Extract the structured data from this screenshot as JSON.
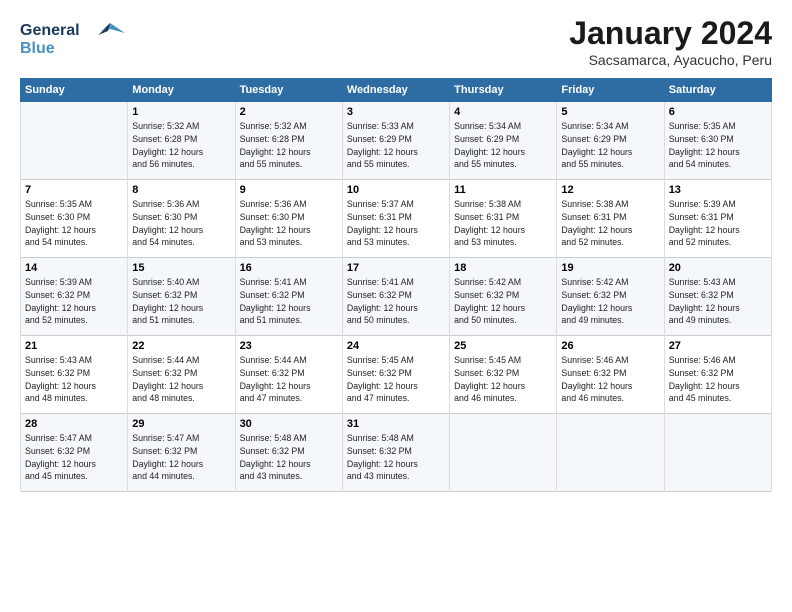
{
  "logo": {
    "line1": "General",
    "line2": "Blue"
  },
  "title": "January 2024",
  "subtitle": "Sacsamarca, Ayacucho, Peru",
  "days_of_week": [
    "Sunday",
    "Monday",
    "Tuesday",
    "Wednesday",
    "Thursday",
    "Friday",
    "Saturday"
  ],
  "weeks": [
    [
      {
        "day": "",
        "info": ""
      },
      {
        "day": "1",
        "info": "Sunrise: 5:32 AM\nSunset: 6:28 PM\nDaylight: 12 hours\nand 56 minutes."
      },
      {
        "day": "2",
        "info": "Sunrise: 5:32 AM\nSunset: 6:28 PM\nDaylight: 12 hours\nand 55 minutes."
      },
      {
        "day": "3",
        "info": "Sunrise: 5:33 AM\nSunset: 6:29 PM\nDaylight: 12 hours\nand 55 minutes."
      },
      {
        "day": "4",
        "info": "Sunrise: 5:34 AM\nSunset: 6:29 PM\nDaylight: 12 hours\nand 55 minutes."
      },
      {
        "day": "5",
        "info": "Sunrise: 5:34 AM\nSunset: 6:29 PM\nDaylight: 12 hours\nand 55 minutes."
      },
      {
        "day": "6",
        "info": "Sunrise: 5:35 AM\nSunset: 6:30 PM\nDaylight: 12 hours\nand 54 minutes."
      }
    ],
    [
      {
        "day": "7",
        "info": "Sunrise: 5:35 AM\nSunset: 6:30 PM\nDaylight: 12 hours\nand 54 minutes."
      },
      {
        "day": "8",
        "info": "Sunrise: 5:36 AM\nSunset: 6:30 PM\nDaylight: 12 hours\nand 54 minutes."
      },
      {
        "day": "9",
        "info": "Sunrise: 5:36 AM\nSunset: 6:30 PM\nDaylight: 12 hours\nand 53 minutes."
      },
      {
        "day": "10",
        "info": "Sunrise: 5:37 AM\nSunset: 6:31 PM\nDaylight: 12 hours\nand 53 minutes."
      },
      {
        "day": "11",
        "info": "Sunrise: 5:38 AM\nSunset: 6:31 PM\nDaylight: 12 hours\nand 53 minutes."
      },
      {
        "day": "12",
        "info": "Sunrise: 5:38 AM\nSunset: 6:31 PM\nDaylight: 12 hours\nand 52 minutes."
      },
      {
        "day": "13",
        "info": "Sunrise: 5:39 AM\nSunset: 6:31 PM\nDaylight: 12 hours\nand 52 minutes."
      }
    ],
    [
      {
        "day": "14",
        "info": "Sunrise: 5:39 AM\nSunset: 6:32 PM\nDaylight: 12 hours\nand 52 minutes."
      },
      {
        "day": "15",
        "info": "Sunrise: 5:40 AM\nSunset: 6:32 PM\nDaylight: 12 hours\nand 51 minutes."
      },
      {
        "day": "16",
        "info": "Sunrise: 5:41 AM\nSunset: 6:32 PM\nDaylight: 12 hours\nand 51 minutes."
      },
      {
        "day": "17",
        "info": "Sunrise: 5:41 AM\nSunset: 6:32 PM\nDaylight: 12 hours\nand 50 minutes."
      },
      {
        "day": "18",
        "info": "Sunrise: 5:42 AM\nSunset: 6:32 PM\nDaylight: 12 hours\nand 50 minutes."
      },
      {
        "day": "19",
        "info": "Sunrise: 5:42 AM\nSunset: 6:32 PM\nDaylight: 12 hours\nand 49 minutes."
      },
      {
        "day": "20",
        "info": "Sunrise: 5:43 AM\nSunset: 6:32 PM\nDaylight: 12 hours\nand 49 minutes."
      }
    ],
    [
      {
        "day": "21",
        "info": "Sunrise: 5:43 AM\nSunset: 6:32 PM\nDaylight: 12 hours\nand 48 minutes."
      },
      {
        "day": "22",
        "info": "Sunrise: 5:44 AM\nSunset: 6:32 PM\nDaylight: 12 hours\nand 48 minutes."
      },
      {
        "day": "23",
        "info": "Sunrise: 5:44 AM\nSunset: 6:32 PM\nDaylight: 12 hours\nand 47 minutes."
      },
      {
        "day": "24",
        "info": "Sunrise: 5:45 AM\nSunset: 6:32 PM\nDaylight: 12 hours\nand 47 minutes."
      },
      {
        "day": "25",
        "info": "Sunrise: 5:45 AM\nSunset: 6:32 PM\nDaylight: 12 hours\nand 46 minutes."
      },
      {
        "day": "26",
        "info": "Sunrise: 5:46 AM\nSunset: 6:32 PM\nDaylight: 12 hours\nand 46 minutes."
      },
      {
        "day": "27",
        "info": "Sunrise: 5:46 AM\nSunset: 6:32 PM\nDaylight: 12 hours\nand 45 minutes."
      }
    ],
    [
      {
        "day": "28",
        "info": "Sunrise: 5:47 AM\nSunset: 6:32 PM\nDaylight: 12 hours\nand 45 minutes."
      },
      {
        "day": "29",
        "info": "Sunrise: 5:47 AM\nSunset: 6:32 PM\nDaylight: 12 hours\nand 44 minutes."
      },
      {
        "day": "30",
        "info": "Sunrise: 5:48 AM\nSunset: 6:32 PM\nDaylight: 12 hours\nand 43 minutes."
      },
      {
        "day": "31",
        "info": "Sunrise: 5:48 AM\nSunset: 6:32 PM\nDaylight: 12 hours\nand 43 minutes."
      },
      {
        "day": "",
        "info": ""
      },
      {
        "day": "",
        "info": ""
      },
      {
        "day": "",
        "info": ""
      }
    ]
  ]
}
